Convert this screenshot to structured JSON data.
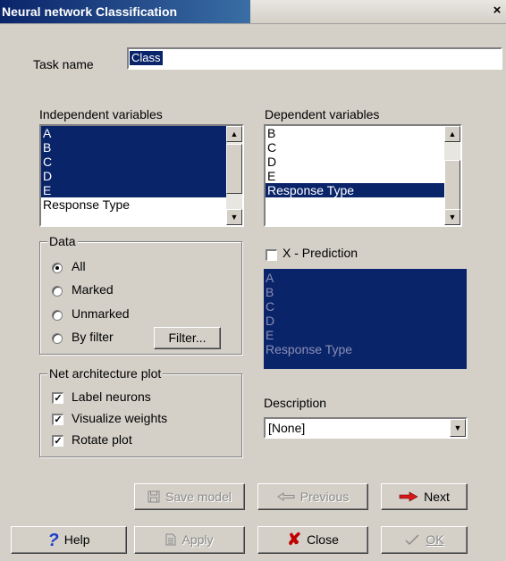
{
  "window": {
    "title": "Neural network Classification",
    "close_glyph": "×"
  },
  "task": {
    "label": "Task name",
    "value": "Class"
  },
  "independent": {
    "label": "Independent variables",
    "items": [
      "A",
      "B",
      "C",
      "D",
      "E",
      "Response Type"
    ],
    "selected": [
      true,
      true,
      true,
      true,
      true,
      false
    ]
  },
  "dependent": {
    "label": "Dependent variables",
    "items": [
      "B",
      "C",
      "D",
      "E",
      "Response Type"
    ],
    "selected": [
      false,
      false,
      false,
      false,
      true
    ]
  },
  "data_group": {
    "legend": "Data",
    "options": [
      "All",
      "Marked",
      "Unmarked",
      "By filter"
    ],
    "selected_index": 0,
    "filter_button": "Filter..."
  },
  "xprediction": {
    "label": "X - Prediction",
    "checked": false,
    "items": [
      "A",
      "B",
      "C",
      "D",
      "E",
      "Response Type"
    ]
  },
  "net_group": {
    "legend": "Net architecture plot",
    "options": [
      {
        "label": "Label neurons",
        "checked": true
      },
      {
        "label": "Visualize weights",
        "checked": true
      },
      {
        "label": "Rotate plot",
        "checked": true
      }
    ]
  },
  "description": {
    "label": "Description",
    "value": "[None]"
  },
  "buttons": {
    "save_model": "Save model",
    "previous": "Previous",
    "next": "Next",
    "help": "Help",
    "apply": "Apply",
    "close": "Close",
    "ok": "OK"
  },
  "icons": {
    "save": "floppy-disk-icon",
    "previous": "arrow-left-icon",
    "next": "arrow-right-icon",
    "help": "question-mark-icon",
    "apply": "document-icon",
    "close": "x-icon",
    "ok": "checkmark-icon"
  },
  "colors": {
    "selection": "#0a246a",
    "next_arrow": "#d81818",
    "close_x": "#c00000",
    "help_q": "#1a3ec8"
  }
}
